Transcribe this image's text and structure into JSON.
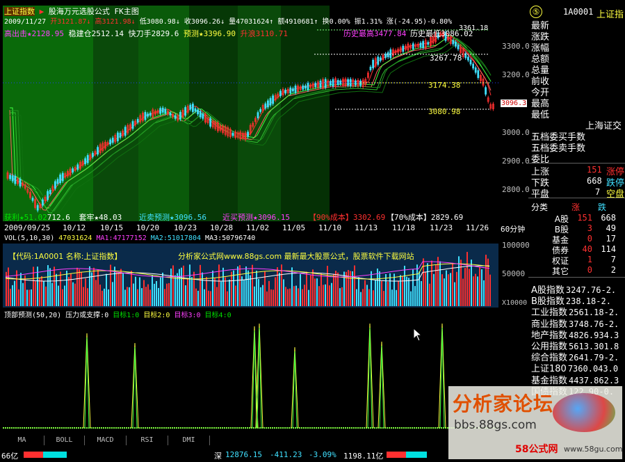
{
  "header": {
    "index_label": "上证指数",
    "formula_label": "股海万元选股公式",
    "chart_mode": "FK主图",
    "date": "2009/11/27",
    "open": "开3121.87",
    "high": "高3121.98",
    "low": "低3080.98",
    "close": "收3096.26",
    "volume": "量47031624",
    "amount": "额4910681",
    "turnover": "换0.00%",
    "amplitude": "振1.31%",
    "change": "涨(-24.95)-0.80%"
  },
  "overlay": {
    "high_point": "高出击★2128.95",
    "build_pos": "稳建仓2512.14",
    "quick_blade": "快刀手2829.6",
    "forecast": "预测★3396.90",
    "rise_watch": "升浪3110.71",
    "hist_high": "历史最高3477.84",
    "hist_low_short": "历史最低",
    "hist_low_value": "3086.02",
    "top_value": "3361.18",
    "line_1": "3267.78",
    "line_2": "3174.38",
    "line_3": "3080.98",
    "profit": "获利★51.02",
    "profit_val": "712.6",
    "trap": "套牢★48.03",
    "near_sell": "近卖预测★3096.56",
    "near_buy": "近买预测★3096.15",
    "cost90": "【90%成本】3302.69",
    "cost70": "【70%成本】2829.69"
  },
  "price_axis": [
    "3300.0",
    "3200.0",
    "3096.3",
    "3000.0",
    "2900.0",
    "2800.0"
  ],
  "date_axis": [
    "2009/09/25",
    "10/12",
    "10/15",
    "10/20",
    "10/23",
    "10/28",
    "11/02",
    "11/05",
    "11/10",
    "11/13",
    "11/18",
    "11/23",
    "11/26",
    "60分钟"
  ],
  "volume_panel": {
    "header": "VOL(5,10,30)",
    "vol": "47031624",
    "ma1": "MA1:47177152",
    "ma2": "MA2:51017804",
    "ma3": "MA3:50796740",
    "info": "【代码:1A0001 名称:上证指数】",
    "site": "分析家公式网www.88gs.com 最新最大股票公式，股票软件下载网站",
    "axis_top": "100000",
    "axis_mid": "50000",
    "axis_unit": "X10000"
  },
  "indicator_panel": {
    "title": "顶部预测(50,20)",
    "pressure": "压力或支撑:0",
    "target1": "目标1:0",
    "target2": "目标2:0",
    "target3": "目标3:0",
    "target4": "目标4:0"
  },
  "right_panel": {
    "badge": "⑤",
    "code": "1A0001",
    "name": "上证指",
    "labels": [
      "最新",
      "涨跌",
      "涨幅",
      "总额",
      "总量",
      "前收",
      "今开",
      "最高",
      "最低"
    ],
    "market": "上海证交",
    "order_buy": "五档委买手数",
    "order_sell": "五档委卖手数",
    "ratio": "委比",
    "up": {
      "label": "上涨",
      "value": "151",
      "suffix": "涨停"
    },
    "down": {
      "label": "下跌",
      "value": "668",
      "suffix": "跌停"
    },
    "flat": {
      "label": "平盘",
      "value": "7",
      "suffix": "空盘"
    },
    "table_header": [
      "分类",
      "涨",
      "跌"
    ],
    "table_rows": [
      {
        "name": "A股",
        "up": "151",
        "down": "668"
      },
      {
        "name": "B股",
        "up": "3",
        "down": "49"
      },
      {
        "name": "基金",
        "up": "0",
        "down": "17"
      },
      {
        "name": "债券",
        "up": "40",
        "down": "114"
      },
      {
        "name": "权证",
        "up": "1",
        "down": "7"
      },
      {
        "name": "其它",
        "up": "0",
        "down": "2"
      }
    ],
    "indices": [
      {
        "name": "A股指数",
        "value": "3247.76-2."
      },
      {
        "name": "B股指数",
        "value": "238.18-2."
      },
      {
        "name": "工业指数",
        "value": "2561.18-2."
      },
      {
        "name": "商业指数",
        "value": "3748.76-2."
      },
      {
        "name": "地产指数",
        "value": "4826.934.3"
      },
      {
        "name": "公用指数",
        "value": "5613.301.8"
      },
      {
        "name": "综合指数",
        "value": "2641.79-2."
      },
      {
        "name": "上证180",
        "value": "7360.043.0"
      },
      {
        "name": "基金指数",
        "value": "4437.862.3"
      },
      {
        "name": "国债指数",
        "value": "122.90-0."
      }
    ]
  },
  "tabs": [
    "MA",
    "BOLL",
    "MACD",
    "RSI",
    "DMI"
  ],
  "status": {
    "left": "66亿",
    "shen_label": "深",
    "shen_value": "12876.15",
    "shen_change": "-411.23",
    "shen_pct": "-3.09%",
    "shen_amount": "1198.11亿"
  },
  "watermark": {
    "title": "分析家论坛",
    "url": "bbs.88gs.com",
    "brand": "58公式网",
    "brand_url": "www.58gu.com"
  },
  "colors": {
    "up": "#ff3030",
    "down": "#00e0e0",
    "bg_green": "#0a5a0a",
    "accent": "#ffff40"
  }
}
